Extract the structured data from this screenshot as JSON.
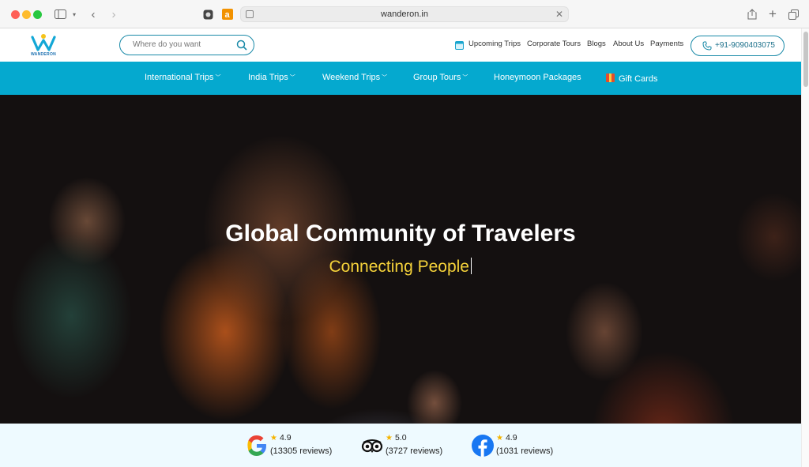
{
  "browser": {
    "url": "wanderon.in"
  },
  "header": {
    "logo_text": "WANDERON",
    "search_placeholder": "Where do you want",
    "links": [
      {
        "label": "Upcoming Trips"
      },
      {
        "label": "Corporate Tours"
      },
      {
        "label": "Blogs"
      },
      {
        "label": "About Us"
      },
      {
        "label": "Payments"
      }
    ],
    "phone": "+91-9090403075"
  },
  "nav": {
    "items": [
      {
        "label": "International Trips",
        "dropdown": true
      },
      {
        "label": "India Trips",
        "dropdown": true
      },
      {
        "label": "Weekend Trips",
        "dropdown": true
      },
      {
        "label": "Group Tours",
        "dropdown": true
      },
      {
        "label": "Honeymoon Packages",
        "dropdown": false
      },
      {
        "label": "Gift Cards",
        "dropdown": false
      }
    ]
  },
  "hero": {
    "title": "Global Community of Travelers",
    "subtitle": "Connecting People"
  },
  "reviews": [
    {
      "source_icon": "google-icon",
      "rating": "4.9",
      "count": "(13305 reviews)"
    },
    {
      "source_icon": "tripadvisor-icon",
      "rating": "5.0",
      "count": "(3727 reviews)"
    },
    {
      "source_icon": "facebook-icon",
      "rating": "4.9",
      "count": "(1031 reviews)"
    }
  ],
  "colors": {
    "nav_bg": "#05a9cf",
    "accent": "#1a8aa8",
    "hero_subtitle": "#f5d23a"
  }
}
